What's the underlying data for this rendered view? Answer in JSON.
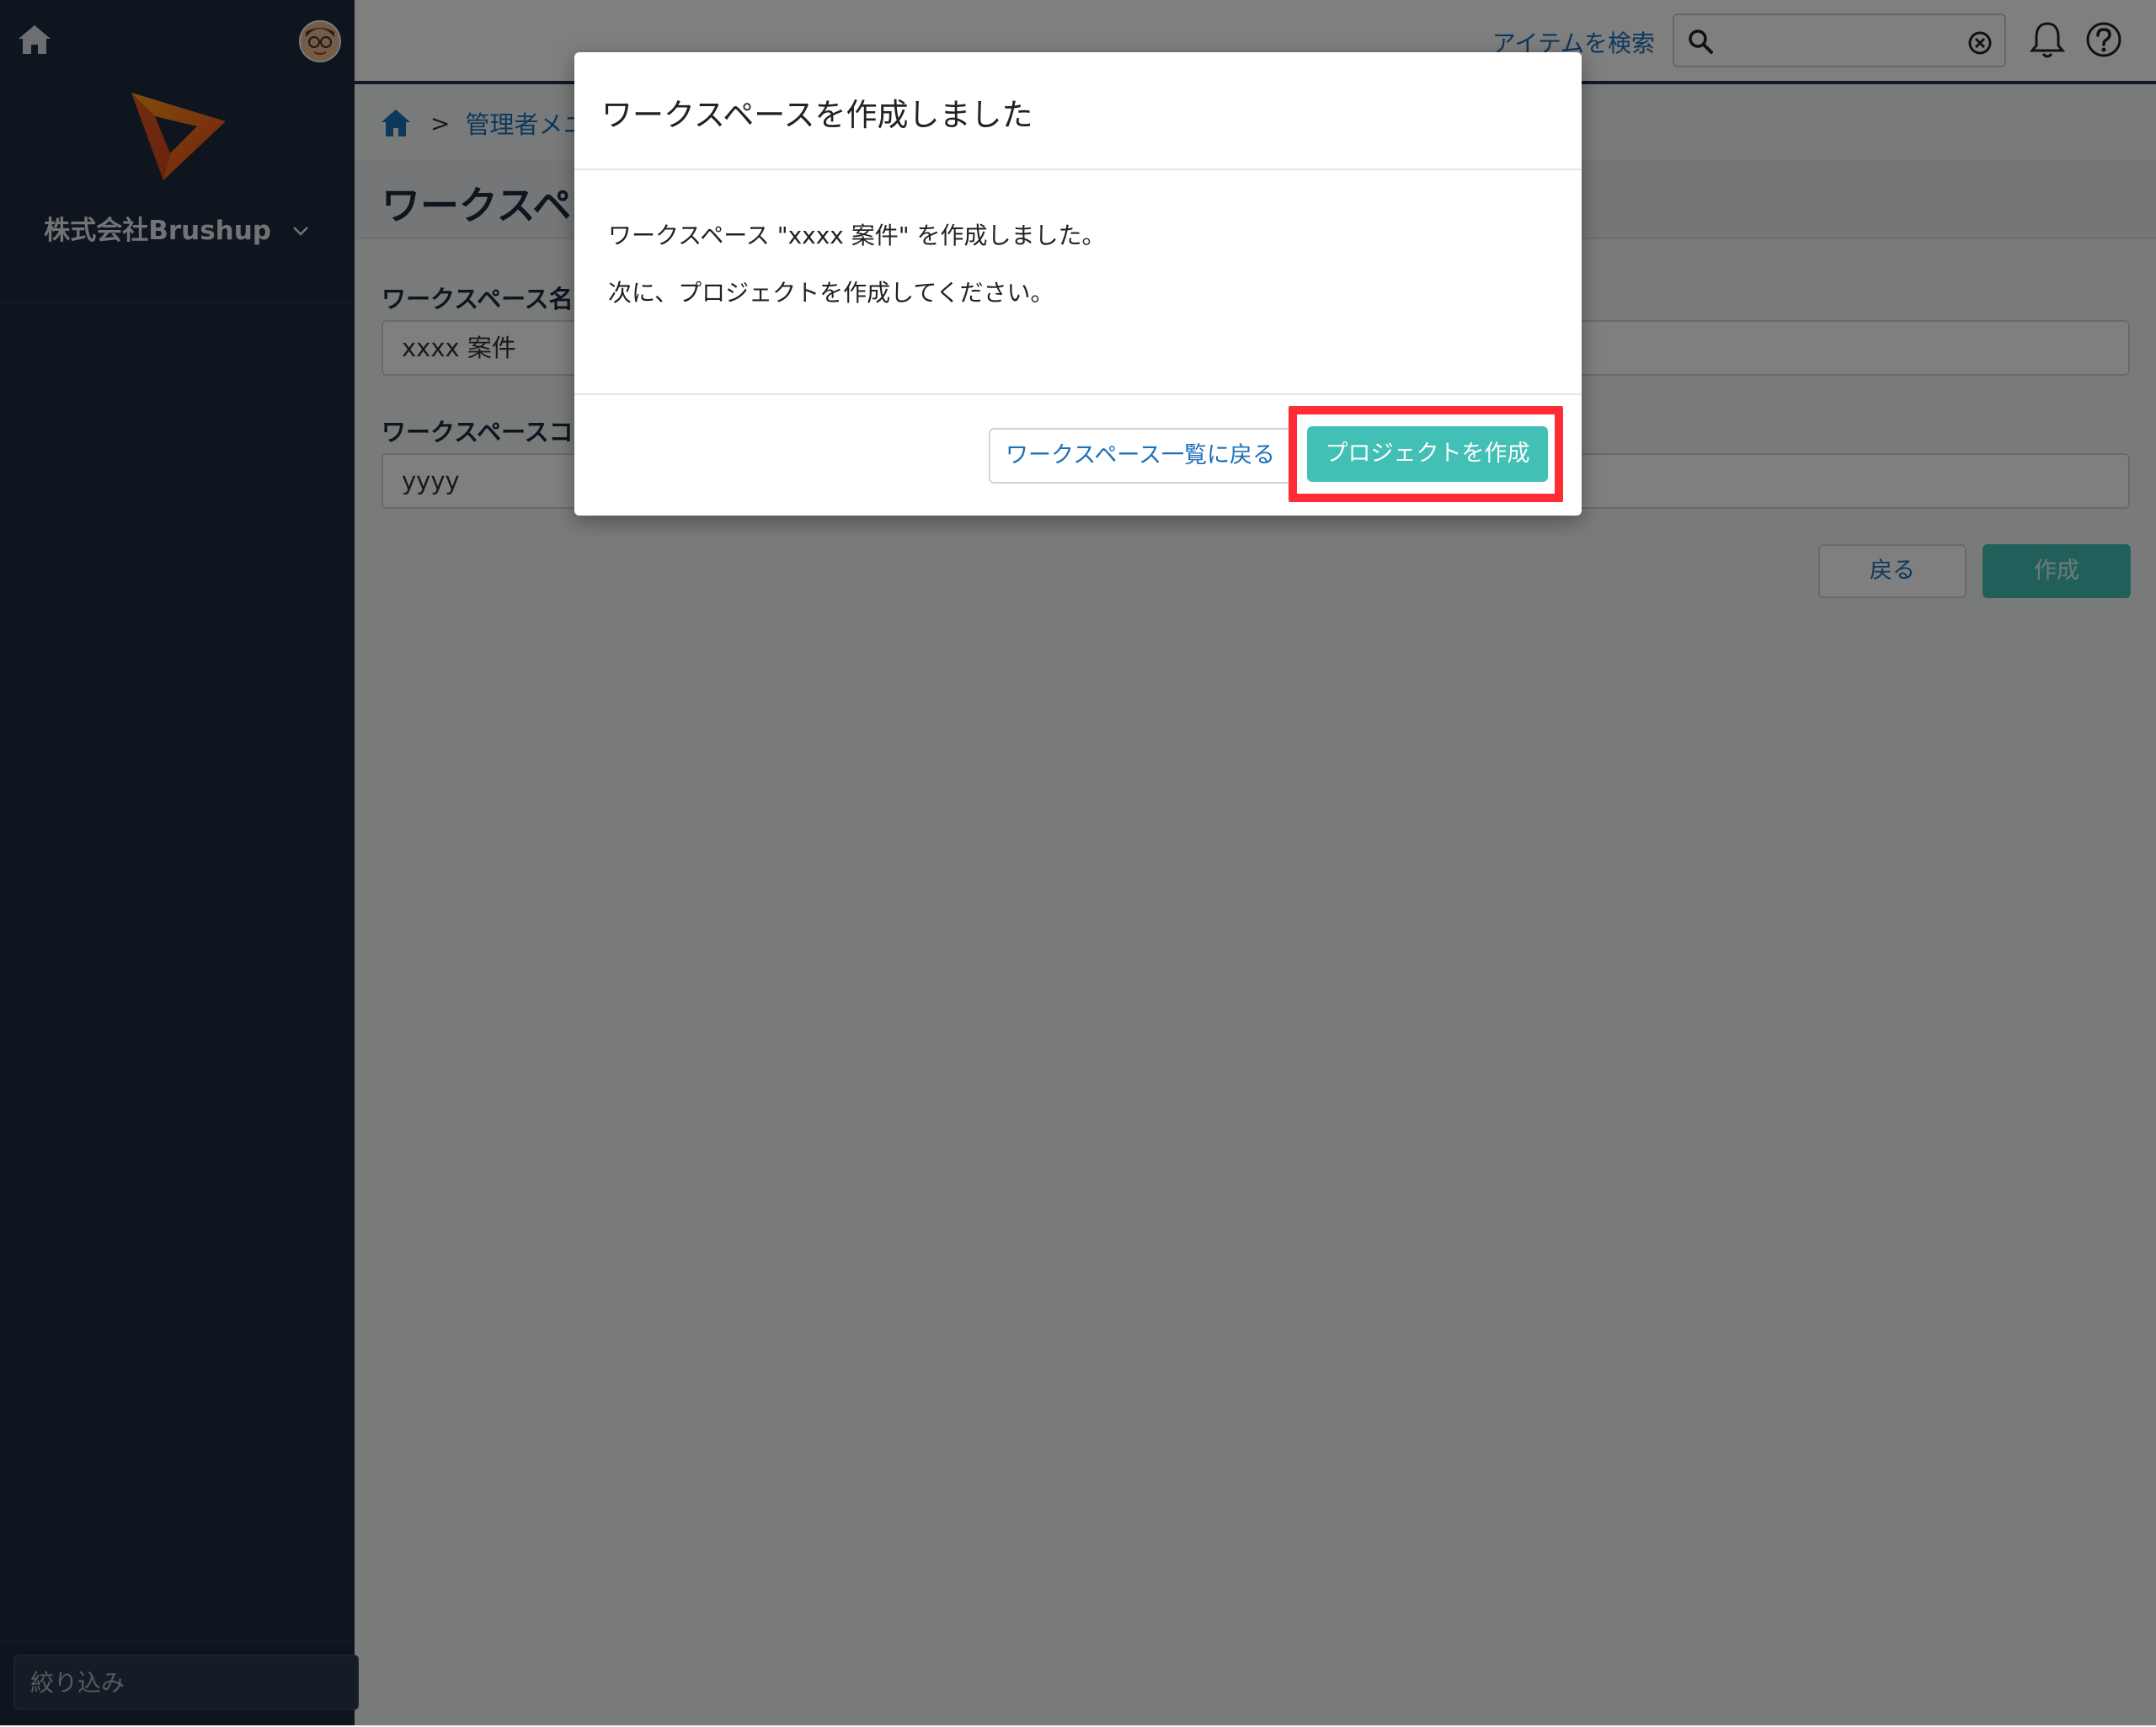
{
  "sidebar": {
    "org_name": "株式会社Brushup",
    "filter_placeholder": "絞り込み"
  },
  "topbar": {
    "search_label": "アイテムを検索",
    "search_value": ""
  },
  "breadcrumb": {
    "crumb": "管理者メニ"
  },
  "page": {
    "title": "ワークスペ",
    "fields": [
      {
        "label": "ワークスペース名",
        "value": "xxxx 案件"
      },
      {
        "label": "ワークスペースコー",
        "value": "yyyy"
      }
    ],
    "back_label": "戻る",
    "create_label": "作成"
  },
  "modal": {
    "title": "ワークスペースを作成しました",
    "message1": "ワークスペース \"xxxx 案件\" を作成しました。",
    "message2": "次に、プロジェクトを作成してください。",
    "back_to_list_label": "ワークスペース一覧に戻る",
    "create_project_label": "プロジェクトを作成"
  },
  "colors": {
    "sidebar_bg": "#1d2a3e",
    "accent_teal": "#43c0b5",
    "link_blue": "#1d6fb8",
    "highlight_red": "#ff2b35"
  },
  "icons": [
    "home-icon",
    "avatar",
    "brushup-logo",
    "chevron-down-icon",
    "search-icon",
    "clear-icon",
    "bell-icon",
    "help-icon"
  ]
}
